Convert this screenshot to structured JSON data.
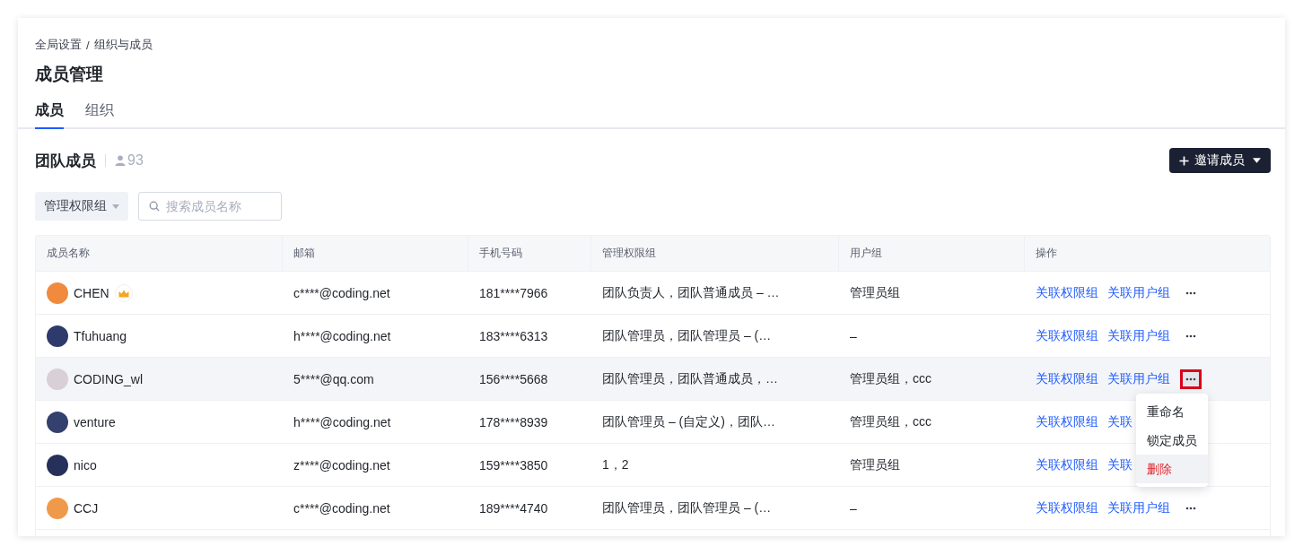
{
  "breadcrumb": [
    "全局设置",
    "组织与成员"
  ],
  "breadcrumb_separator": "/",
  "title": "成员管理",
  "tabs": [
    {
      "label": "成员",
      "selected": true
    },
    {
      "label": "组织",
      "selected": false
    }
  ],
  "section": {
    "title": "团队成员",
    "count": "93"
  },
  "invite_button": {
    "label": "邀请成员"
  },
  "filter": {
    "label": "管理权限组"
  },
  "search": {
    "placeholder": "搜索成员名称"
  },
  "table": {
    "columns": [
      "成员名称",
      "邮箱",
      "手机号码",
      "管理权限组",
      "用户组",
      "操作"
    ],
    "rows": [
      {
        "name": "CHEN",
        "color": "#f08a3c",
        "owner": true,
        "email": "c****@coding.net",
        "phone": "181****7966",
        "admin_groups": "团队负责人，团队普通成员 – …",
        "user_groups": "管理员组",
        "actions": [
          "关联权限组",
          "关联用户组"
        ],
        "more_hidden": false,
        "menu_open": false,
        "hovered": false
      },
      {
        "name": "Tfuhuang",
        "color": "#2e3a6b",
        "owner": false,
        "email": "h****@coding.net",
        "phone": "183****6313",
        "admin_groups": "团队管理员，团队管理员 – (…",
        "user_groups": "–",
        "actions": [
          "关联权限组",
          "关联用户组"
        ],
        "more_hidden": false,
        "menu_open": false,
        "hovered": false
      },
      {
        "name": "CODING_wl",
        "color": "#d9cfd6",
        "owner": false,
        "email": "5****@qq.com",
        "phone": "156****5668",
        "admin_groups": "团队管理员，团队普通成员，…",
        "user_groups": "管理员组，ccc",
        "actions": [
          "关联权限组",
          "关联用户组"
        ],
        "more_hidden": false,
        "menu_open": true,
        "hovered": true
      },
      {
        "name": "venture",
        "color": "#34406e",
        "owner": false,
        "email": "h****@coding.net",
        "phone": "178****8939",
        "admin_groups": "团队管理员 – (自定义)，团队…",
        "user_groups": "管理员组，ccc",
        "actions": [
          "关联权限组",
          "关联"
        ],
        "more_hidden": true,
        "menu_open": false,
        "hovered": false
      },
      {
        "name": "nico",
        "color": "#26305a",
        "owner": false,
        "email": "z****@coding.net",
        "phone": "159****3850",
        "admin_groups": "1，2",
        "user_groups": "管理员组",
        "actions": [
          "关联权限组",
          "关联"
        ],
        "more_hidden": true,
        "menu_open": false,
        "hovered": false
      },
      {
        "name": "CCJ",
        "color": "#ef9a4a",
        "owner": false,
        "email": "c****@coding.net",
        "phone": "189****4740",
        "admin_groups": "团队管理员，团队管理员 – (…",
        "user_groups": "–",
        "actions": [
          "关联权限组",
          "关联用户组"
        ],
        "more_hidden": false,
        "menu_open": false,
        "hovered": false
      }
    ]
  },
  "menu": {
    "items": [
      {
        "label": "重命名",
        "kind": "normal",
        "highlighted": false
      },
      {
        "label": "锁定成员",
        "kind": "normal",
        "highlighted": false
      },
      {
        "label": "删除",
        "kind": "danger",
        "highlighted": true
      }
    ]
  }
}
